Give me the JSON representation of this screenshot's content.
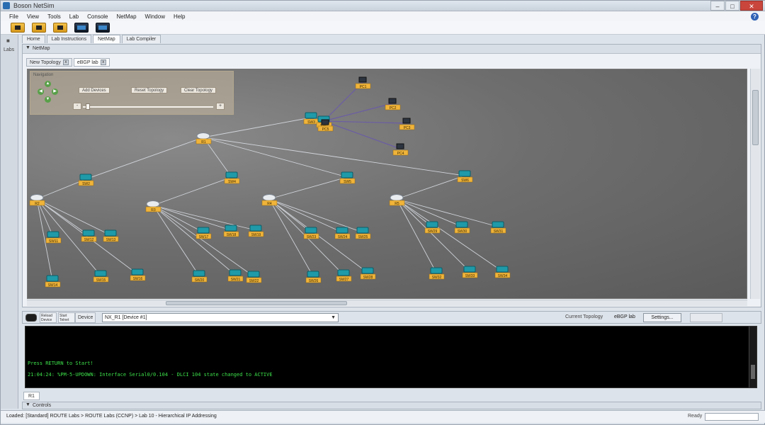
{
  "window": {
    "title": "Boson NetSim"
  },
  "menu": [
    "File",
    "View",
    "Tools",
    "Lab",
    "Console",
    "NetMap",
    "Window",
    "Help"
  ],
  "left_strip": {
    "label": "Labs"
  },
  "main_tabs": [
    {
      "label": "Home"
    },
    {
      "label": "Lab Instructions"
    },
    {
      "label": "NetMap",
      "active": true
    },
    {
      "label": "Lab Compiler"
    }
  ],
  "topology": {
    "header": "NetMap",
    "sub_tabs": [
      {
        "label": "New Topology",
        "active": false
      },
      {
        "label": "eBGP lab",
        "active": true
      }
    ],
    "nav": {
      "title": "Navigation",
      "buttons": [
        "Add Devices",
        "Reset Topology",
        "Clear Topology"
      ],
      "zoom_level": 0.03
    },
    "nodes": [
      {
        "id": "SW3",
        "type": "switch",
        "label": "SW3"
      },
      {
        "id": "SW1",
        "type": "switch",
        "label": "SW1"
      },
      {
        "id": "R1",
        "type": "router",
        "label": "R1"
      },
      {
        "id": "R2",
        "type": "router",
        "label": "R2"
      },
      {
        "id": "R3",
        "type": "router",
        "label": "R3"
      },
      {
        "id": "R4",
        "type": "router",
        "label": "R4"
      },
      {
        "id": "R5",
        "type": "router",
        "label": "R5"
      },
      {
        "id": "SW2",
        "type": "switch",
        "label": "SW2"
      },
      {
        "id": "SW4",
        "type": "switch",
        "label": "SW4"
      },
      {
        "id": "SW5",
        "type": "switch",
        "label": "SW5"
      },
      {
        "id": "SW6",
        "type": "switch",
        "label": "SW6"
      },
      {
        "id": "SW7",
        "type": "switch",
        "label": "SW7"
      },
      {
        "id": "SW8",
        "type": "switch",
        "label": "SW8"
      },
      {
        "id": "SW9",
        "type": "switch",
        "label": "SW9"
      },
      {
        "id": "SW10",
        "type": "switch",
        "label": "SW10"
      },
      {
        "id": "PC1",
        "type": "pc",
        "label": "PC1"
      },
      {
        "id": "PC2",
        "type": "pc",
        "label": "PC2"
      },
      {
        "id": "PC3",
        "type": "pc",
        "label": "PC3"
      },
      {
        "id": "PC4",
        "type": "pc",
        "label": "PC4"
      },
      {
        "id": "PC5",
        "type": "pc",
        "label": "PC5"
      },
      {
        "id": "A1",
        "type": "switch",
        "label": "SW11"
      },
      {
        "id": "A2",
        "type": "switch",
        "label": "SW12"
      },
      {
        "id": "A3",
        "type": "switch",
        "label": "SW13"
      },
      {
        "id": "A4",
        "type": "switch",
        "label": "SW14"
      },
      {
        "id": "A5",
        "type": "switch",
        "label": "SW15"
      },
      {
        "id": "A6",
        "type": "switch",
        "label": "SW16"
      },
      {
        "id": "B1",
        "type": "switch",
        "label": "SW17"
      },
      {
        "id": "B2",
        "type": "switch",
        "label": "SW18"
      },
      {
        "id": "B3",
        "type": "switch",
        "label": "SW19"
      },
      {
        "id": "B4",
        "type": "switch",
        "label": "SW20"
      },
      {
        "id": "B5",
        "type": "switch",
        "label": "SW21"
      },
      {
        "id": "B6",
        "type": "switch",
        "label": "SW22"
      },
      {
        "id": "C1",
        "type": "switch",
        "label": "SW23"
      },
      {
        "id": "C2",
        "type": "switch",
        "label": "SW24"
      },
      {
        "id": "C3",
        "type": "switch",
        "label": "SW25"
      },
      {
        "id": "C4",
        "type": "switch",
        "label": "SW26"
      },
      {
        "id": "C5",
        "type": "switch",
        "label": "SW27"
      },
      {
        "id": "C6",
        "type": "switch",
        "label": "SW28"
      },
      {
        "id": "D1",
        "type": "switch",
        "label": "SW29"
      },
      {
        "id": "D2",
        "type": "switch",
        "label": "SW30"
      },
      {
        "id": "D3",
        "type": "switch",
        "label": "SW31"
      },
      {
        "id": "D4",
        "type": "switch",
        "label": "SW32"
      },
      {
        "id": "D5",
        "type": "switch",
        "label": "SW33"
      },
      {
        "id": "D6",
        "type": "switch",
        "label": "SW34"
      }
    ],
    "links": [
      [
        "R1",
        "SW3"
      ],
      [
        "SW3",
        "SW1"
      ],
      [
        "R1",
        "SW2"
      ],
      [
        "R1",
        "SW4"
      ],
      [
        "R1",
        "SW5"
      ],
      [
        "R1",
        "SW6"
      ],
      [
        "SW2",
        "R2"
      ],
      [
        "SW4",
        "R3"
      ],
      [
        "SW5",
        "R4"
      ],
      [
        "SW6",
        "R5"
      ],
      [
        "SW1",
        "PC1"
      ],
      [
        "SW1",
        "PC2"
      ],
      [
        "SW1",
        "PC3"
      ],
      [
        "SW1",
        "PC4"
      ],
      [
        "SW1",
        "PC5"
      ],
      [
        "R2",
        "A1"
      ],
      [
        "R2",
        "A2"
      ],
      [
        "R2",
        "A3"
      ],
      [
        "R2",
        "A4"
      ],
      [
        "R2",
        "A5"
      ],
      [
        "R2",
        "A6"
      ],
      [
        "R3",
        "B1"
      ],
      [
        "R3",
        "B2"
      ],
      [
        "R3",
        "B3"
      ],
      [
        "R3",
        "B4"
      ],
      [
        "R3",
        "B5"
      ],
      [
        "R3",
        "B6"
      ],
      [
        "R4",
        "C1"
      ],
      [
        "R4",
        "C2"
      ],
      [
        "R4",
        "C3"
      ],
      [
        "R4",
        "C4"
      ],
      [
        "R4",
        "C5"
      ],
      [
        "R4",
        "C6"
      ],
      [
        "R5",
        "D1"
      ],
      [
        "R5",
        "D2"
      ],
      [
        "R5",
        "D3"
      ],
      [
        "R5",
        "D4"
      ],
      [
        "R5",
        "D5"
      ],
      [
        "R5",
        "D6"
      ]
    ]
  },
  "console": {
    "buttons": [
      "Reload Device",
      "Start Telnet"
    ],
    "device_label": "Device",
    "device_value": "NX_R1 [Device #1]",
    "current_topology_label": "Current Topology",
    "current_topology_value": "eBGP lab",
    "settings_label": "Settings...",
    "lines": [
      "Press RETURN to Start!",
      "21:04:24: %PM-5-UPDOWN: Interface Serial0/0.104 - DLCI 104 state changed to ACTIVE"
    ],
    "tab": "R1",
    "controls_label": "Controls"
  },
  "status": {
    "text": "Loaded: [Standard] ROUTE Labs > ROUTE Labs (CCNP) > Lab 10 - Hierarchical IP Addressing",
    "ready": "Ready"
  },
  "colors": {
    "node_label_bg": "#f0b43a",
    "link": "#d9dde3",
    "link_pc": "#6a5aa8",
    "terminal_text": "#3ce04a"
  }
}
